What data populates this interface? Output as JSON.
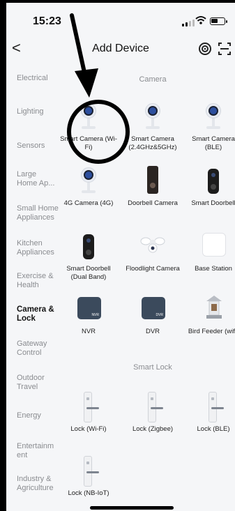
{
  "status": {
    "time": "15:23"
  },
  "header": {
    "back_label": "<",
    "title": "Add Device"
  },
  "sidebar": {
    "items": [
      {
        "label": "Electrical",
        "active": false
      },
      {
        "label": "Lighting",
        "active": false
      },
      {
        "label": "Sensors",
        "active": false
      },
      {
        "label": "Large Home Ap...",
        "active": false
      },
      {
        "label": "Small Home Appliances",
        "active": false
      },
      {
        "label": "Kitchen Appliances",
        "active": false
      },
      {
        "label": "Exercise & Health",
        "active": false
      },
      {
        "label": "Camera & Lock",
        "active": true
      },
      {
        "label": "Gateway Control",
        "active": false
      },
      {
        "label": "Outdoor Travel",
        "active": false
      },
      {
        "label": "Energy",
        "active": false
      },
      {
        "label": "Entertainm ent",
        "active": false
      },
      {
        "label": "Industry & Agriculture",
        "active": false
      }
    ]
  },
  "sections": {
    "camera": {
      "title": "Camera",
      "devices": [
        {
          "name": "Smart Camera (Wi-Fi)",
          "icon": "camera-icon"
        },
        {
          "name": "Smart Camera (2.4GHz&5GHz)",
          "icon": "camera-icon"
        },
        {
          "name": "Smart Camera (BLE)",
          "icon": "camera-icon"
        },
        {
          "name": "4G Camera (4G)",
          "icon": "camera-icon"
        },
        {
          "name": "Doorbell Camera",
          "icon": "doorbell-icon"
        },
        {
          "name": "Smart Doorbell",
          "icon": "doorbell-icon"
        },
        {
          "name": "Smart Doorbell (Dual Band)",
          "icon": "doorbell-icon"
        },
        {
          "name": "Floodlight Camera",
          "icon": "floodlight-icon"
        },
        {
          "name": "Base Station",
          "icon": "base-station-icon"
        },
        {
          "name": "NVR",
          "icon": "nvr-icon",
          "badge": "NVR"
        },
        {
          "name": "DVR",
          "icon": "dvr-icon",
          "badge": "DVR"
        },
        {
          "name": "Bird Feeder (wifi)",
          "icon": "bird-feeder-icon"
        }
      ]
    },
    "smart_lock": {
      "title": "Smart Lock",
      "devices": [
        {
          "name": "Lock (Wi-Fi)",
          "icon": "lock-icon"
        },
        {
          "name": "Lock (Zigbee)",
          "icon": "lock-icon"
        },
        {
          "name": "Lock (BLE)",
          "icon": "lock-icon"
        },
        {
          "name": "Lock (NB-IoT)",
          "icon": "lock-icon"
        }
      ]
    }
  },
  "colors": {
    "background": "#f5f6f8",
    "text_muted": "#8a8c90",
    "annotation": "#000000"
  }
}
